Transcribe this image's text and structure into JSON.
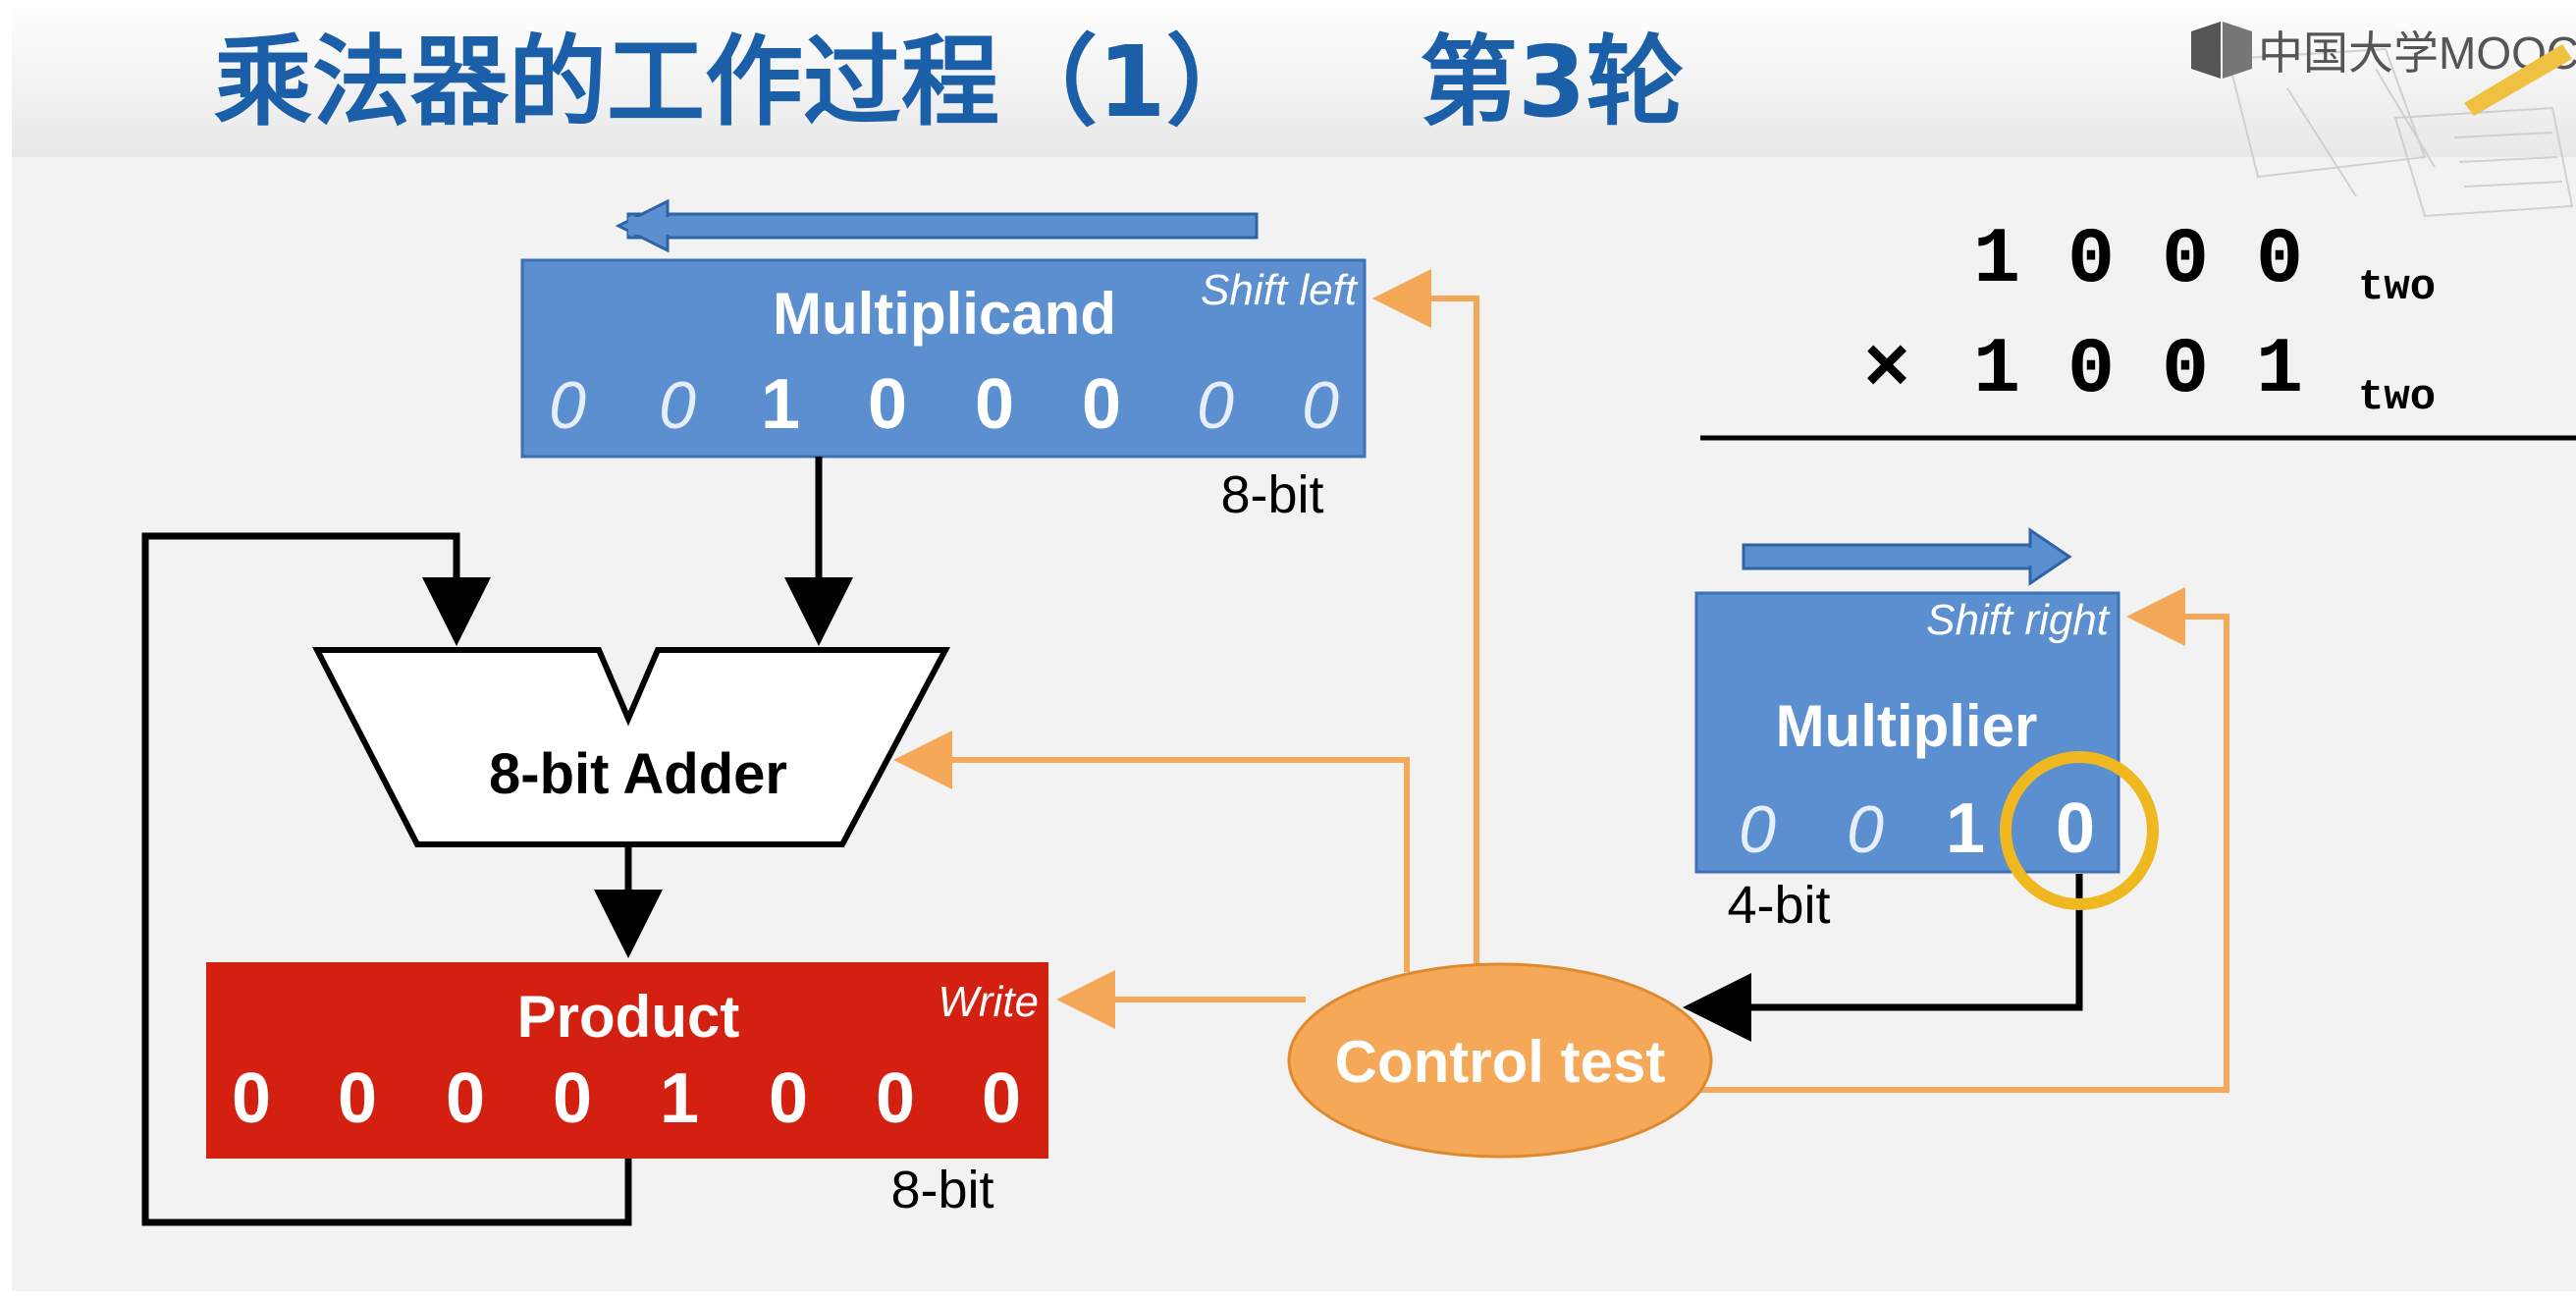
{
  "title": {
    "main": "乘法器的工作过程（1）",
    "round": "第3轮"
  },
  "logo": {
    "text": "中国大学MOOC"
  },
  "colors": {
    "title": "#1a5fa8",
    "register_blue": "#5b8fd0",
    "product_red": "#d42010",
    "control_orange": "#f5a858",
    "highlight_ring": "#f0b820"
  },
  "multiplicand": {
    "label": "Multiplicand",
    "shift_label": "Shift left",
    "width_label": "8-bit",
    "bits": [
      "0",
      "0",
      "1",
      "0",
      "0",
      "0",
      "0",
      "0"
    ]
  },
  "adder": {
    "label": "8-bit Adder"
  },
  "product": {
    "label": "Product",
    "write_label": "Write",
    "width_label": "8-bit",
    "bits": [
      "0",
      "0",
      "0",
      "0",
      "1",
      "0",
      "0",
      "0"
    ]
  },
  "control": {
    "label": "Control test"
  },
  "multiplier": {
    "label": "Multiplier",
    "shift_label": "Shift right",
    "width_label": "4-bit",
    "bits": [
      "0",
      "0",
      "1",
      "0"
    ]
  },
  "equation": {
    "line1_digits": "1 0 0 0",
    "line1_sub": "two",
    "times": "×",
    "line2_digits": "1 0 0 1",
    "line2_sub": "two"
  }
}
